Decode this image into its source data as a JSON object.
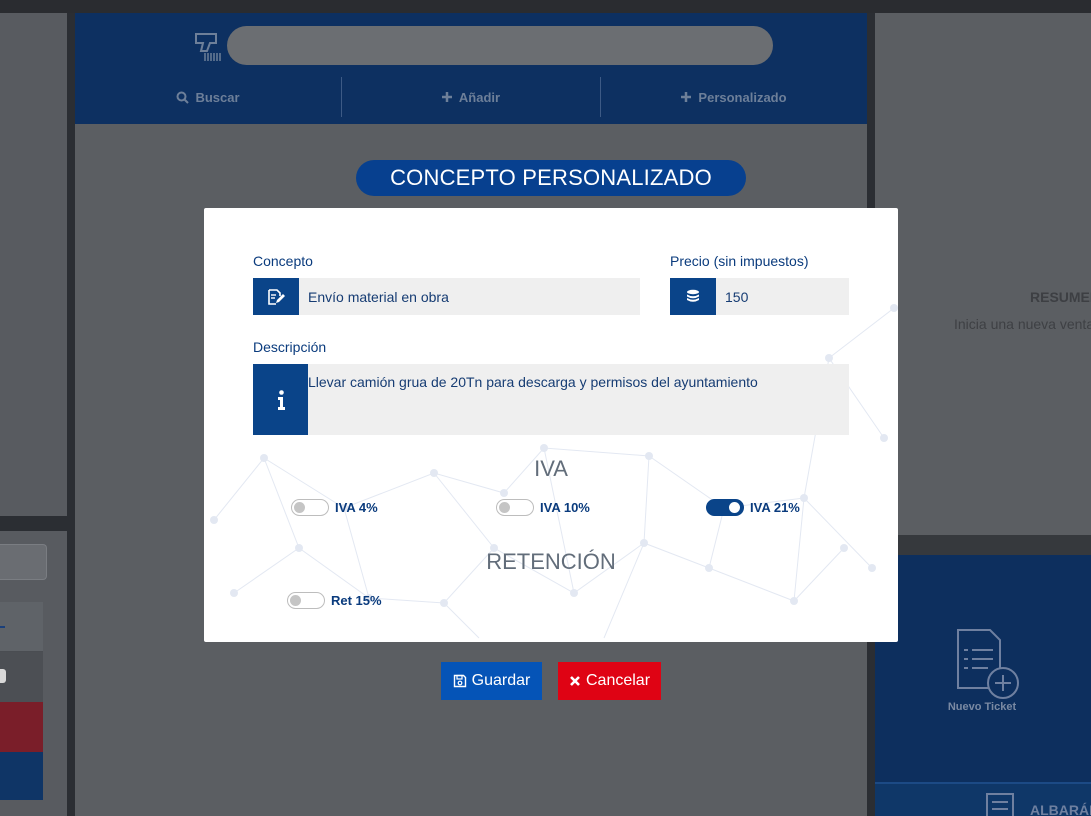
{
  "toolbar": {
    "search_placeholder": "",
    "tabs": [
      {
        "label": "Buscar",
        "icon": "search-icon"
      },
      {
        "label": "Añadir",
        "icon": "plus-icon"
      },
      {
        "label": "Personalizado",
        "icon": "plus-icon"
      }
    ]
  },
  "section_title": "CONCEPTO PERSONALIZADO",
  "modal": {
    "concepto": {
      "label": "Concepto",
      "value": "Envío material en obra",
      "icon": "edit-document-icon"
    },
    "precio": {
      "label": "Precio (sin impuestos)",
      "value": "150",
      "icon": "coins-icon"
    },
    "descripcion": {
      "label": "Descripción",
      "value": "Llevar camión grua de 20Tn para descarga y permisos del ayuntamiento",
      "icon": "info-icon"
    },
    "iva": {
      "title": "IVA",
      "options": [
        {
          "label": "IVA 4%",
          "checked": false
        },
        {
          "label": "IVA 10%",
          "checked": false
        },
        {
          "label": "IVA 21%",
          "checked": true
        }
      ]
    },
    "retencion": {
      "title": "RETENCIÓN",
      "options": [
        {
          "label": "Ret 15%",
          "checked": false
        }
      ]
    }
  },
  "actions": {
    "save_label": "Guardar",
    "cancel_label": "Cancelar"
  },
  "right_panel": {
    "summary_title": "RESUMEN",
    "summary_subtitle": "Inicia una nueva venta",
    "new_ticket_label": "Nuevo Ticket",
    "albaran_label": "ALBARÁN"
  },
  "colors": {
    "primary": "#0a4489",
    "save": "#0554b7",
    "cancel": "#df0314",
    "header": "#0d3061"
  }
}
